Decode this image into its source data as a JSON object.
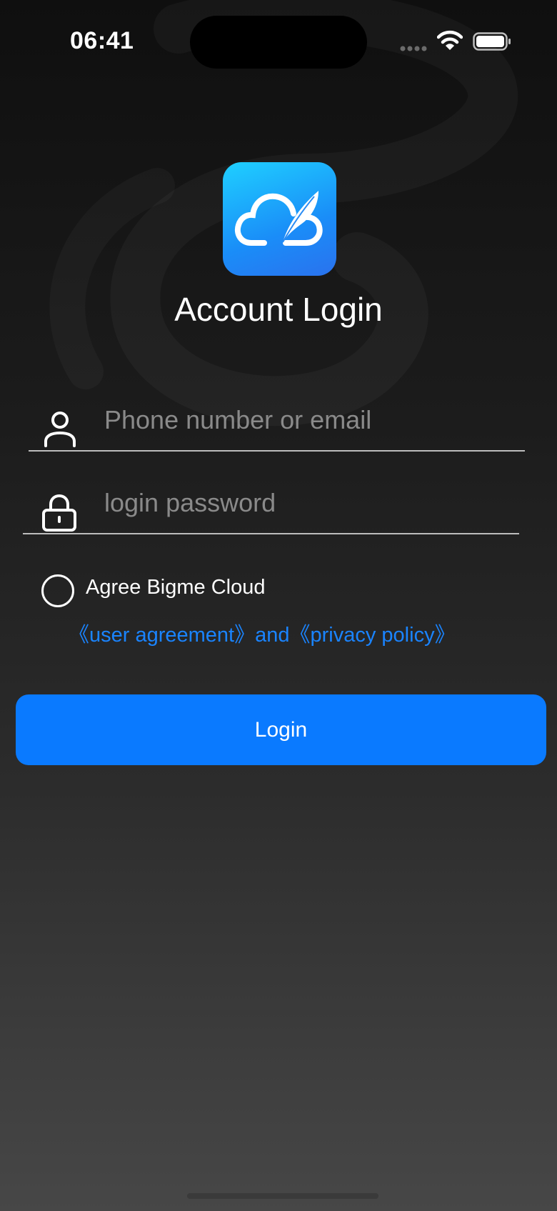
{
  "status_bar": {
    "time": "06:41",
    "icons": [
      "signal-dots-icon",
      "wifi-icon",
      "battery-icon"
    ]
  },
  "app": {
    "logo_icon": "cloud-feather-icon",
    "accent_color": "#0a7aff",
    "link_color": "#1a84ff"
  },
  "login": {
    "title": "Account Login",
    "username_placeholder": "Phone number or email",
    "password_placeholder": "login password",
    "agree_text": "Agree Bigme Cloud",
    "user_agreement_link": "《user agreement》",
    "and_text": "and",
    "privacy_policy_link": "《privacy policy》",
    "login_button": "Login"
  }
}
